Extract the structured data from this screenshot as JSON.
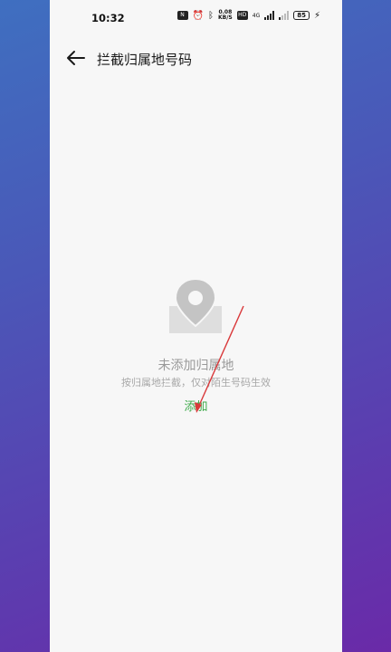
{
  "status_bar": {
    "time": "10:32",
    "net_speed_value": "0.08",
    "net_speed_unit": "KB/S",
    "hd_badge": "HD",
    "signal_label": "4G",
    "battery": "85"
  },
  "header": {
    "title": "拦截归属地号码"
  },
  "empty_state": {
    "title": "未添加归属地",
    "subtitle": "按归属地拦截，仅对陌生号码生效",
    "add_label": "添加"
  },
  "colors": {
    "accent": "#3daa4a",
    "annotation_arrow": "#d9383a"
  },
  "icons": {
    "back": "arrow-left-icon",
    "empty": "location-pin-icon"
  }
}
